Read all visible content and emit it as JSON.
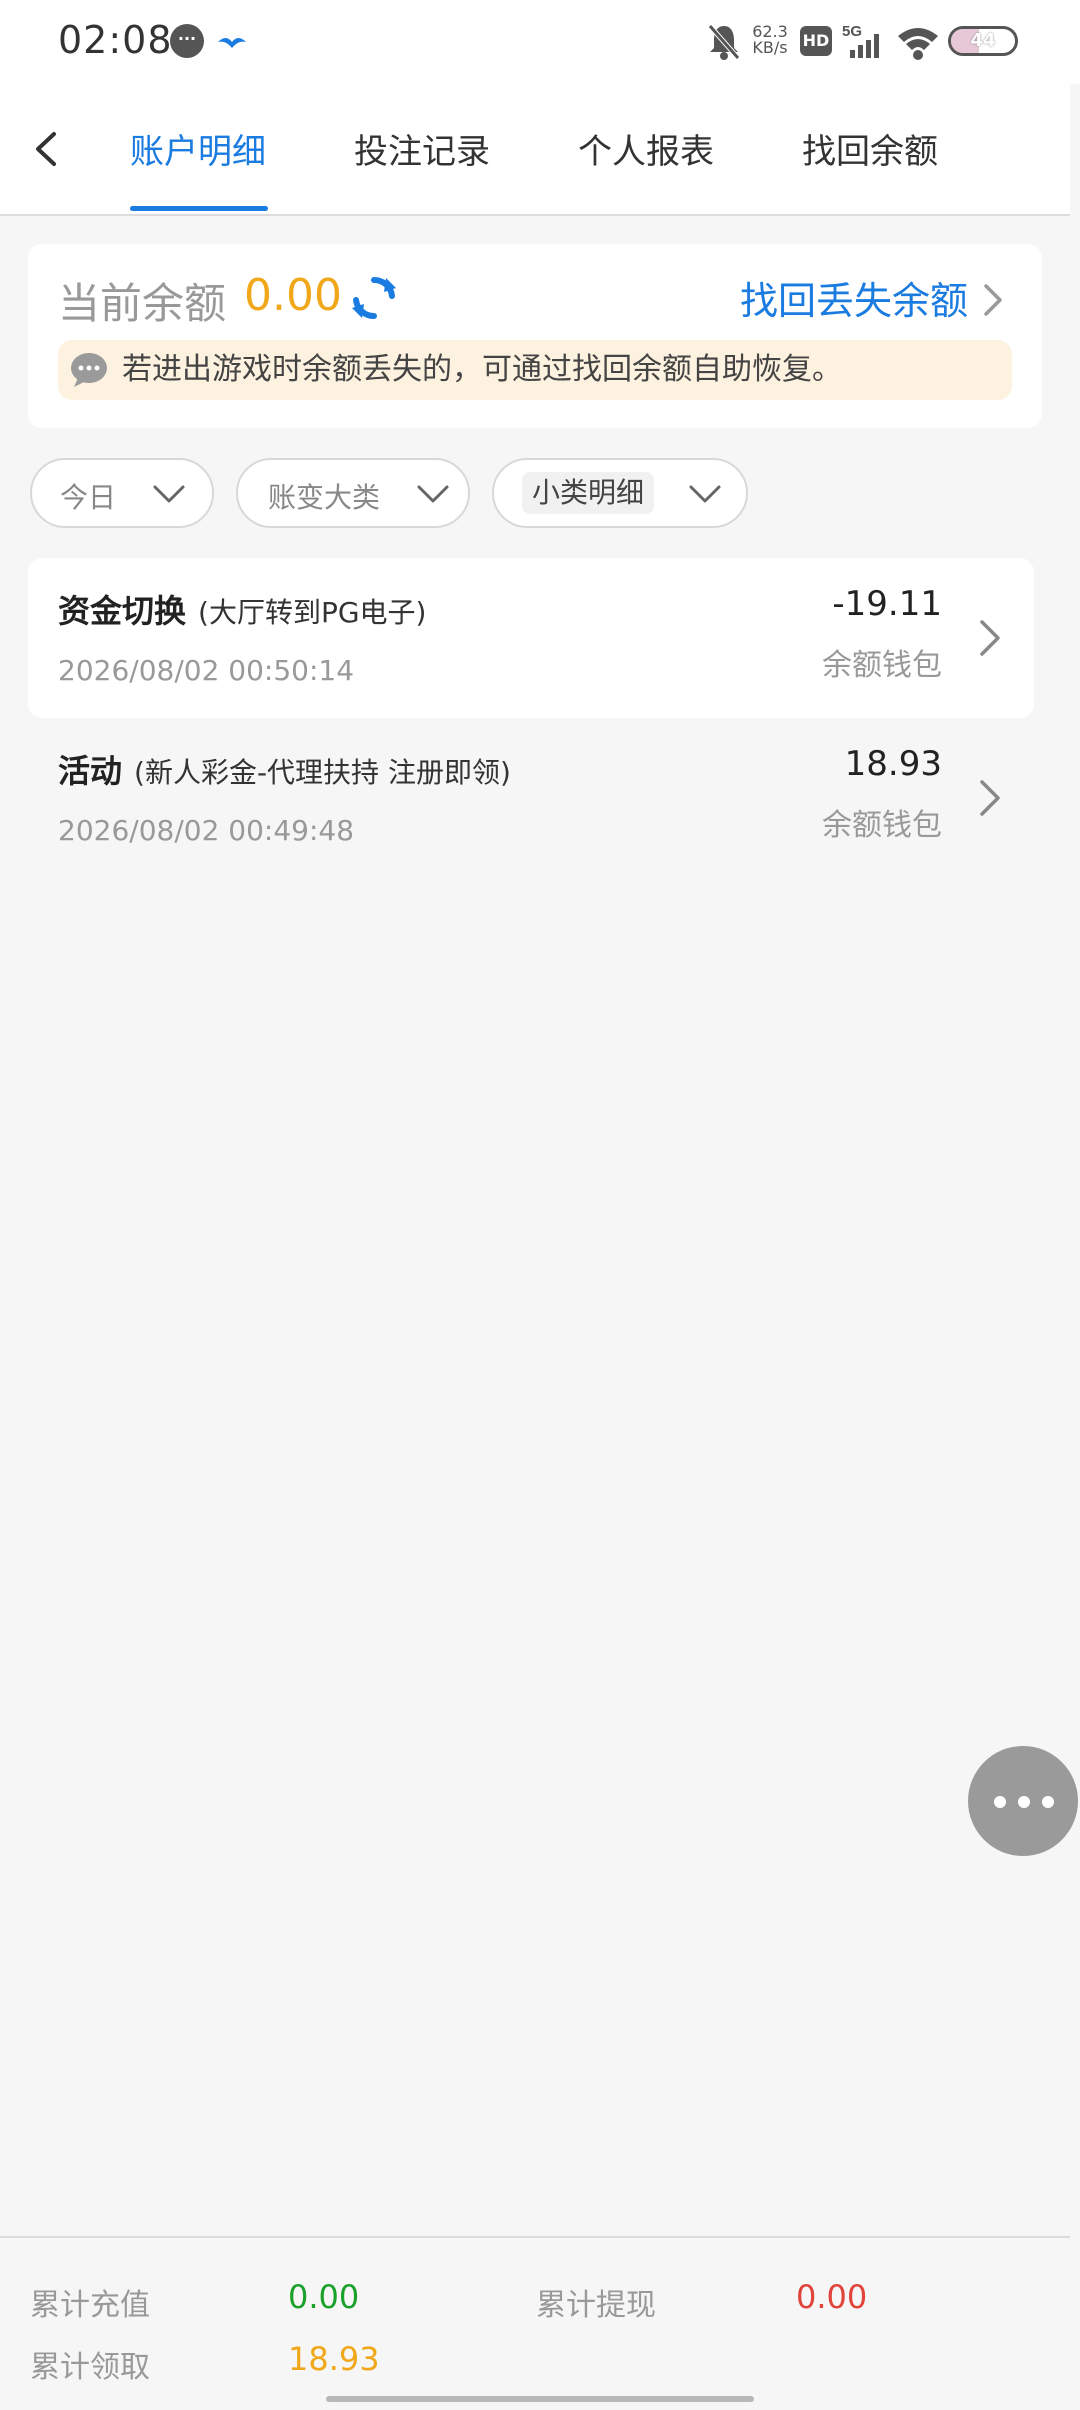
{
  "status_bar": {
    "time": "02:08",
    "net_speed_value": "62.3",
    "net_speed_unit": "KB/s",
    "hd_label": "HD",
    "network_label": "5G",
    "battery_level": "44",
    "battery_fraction": 0.44
  },
  "tabs": [
    {
      "label": "账户明细",
      "active": true
    },
    {
      "label": "投注记录",
      "active": false
    },
    {
      "label": "个人报表",
      "active": false
    },
    {
      "label": "找回余额",
      "active": false
    }
  ],
  "balance": {
    "label": "当前余额",
    "value": "0.00",
    "recover_link": "找回丢失余额",
    "notice": "若进出游戏时余额丢失的，可通过找回余额自助恢复。"
  },
  "filters": {
    "date": "今日",
    "major_category": "账变大类",
    "minor_category": "小类明细"
  },
  "records": [
    {
      "type": "资金切换",
      "detail": "(大厅转到PG电子)",
      "time": "2026/08/02 00:50:14",
      "amount": "-19.11",
      "wallet": "余额钱包"
    },
    {
      "type": "活动",
      "detail": "(新人彩金-代理扶持 注册即领)",
      "time": "2026/08/02 00:49:48",
      "amount": "18.93",
      "wallet": "余额钱包"
    }
  ],
  "summary": {
    "recharge_label": "累计充值",
    "recharge_value": "0.00",
    "withdraw_label": "累计提现",
    "withdraw_value": "0.00",
    "claimed_label": "累计领取",
    "claimed_value": "18.93"
  },
  "colors": {
    "accent": "#1a7be0",
    "balance": "#f0a81a",
    "recharge": "#1aa12b",
    "withdraw": "#e0443a",
    "claimed": "#f0a81a"
  }
}
